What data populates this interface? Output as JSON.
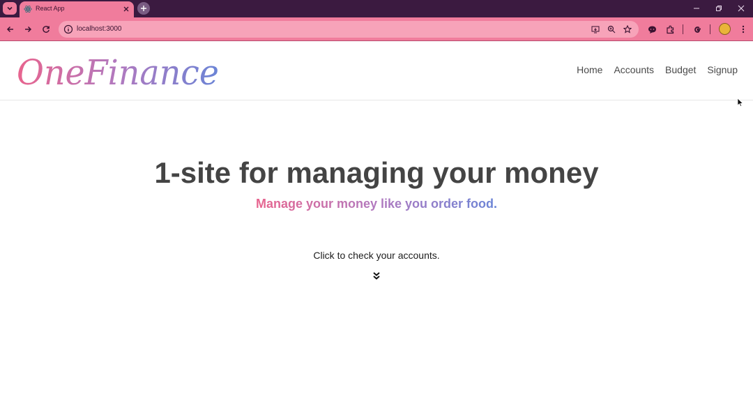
{
  "browser": {
    "tab": {
      "title": "React App"
    },
    "address_bar": {
      "url": "localhost:3000"
    },
    "icons": {
      "tab_search": "chevron-down-icon",
      "favicon": "react-icon",
      "tab_close": "close-icon",
      "new_tab": "plus-icon",
      "minimize": "minimize-icon",
      "restore": "restore-icon",
      "close": "close-icon",
      "back": "arrow-left-icon",
      "forward": "arrow-right-icon",
      "reload": "reload-icon",
      "site_info": "info-icon",
      "install": "install-app-icon",
      "zoom": "zoom-icon",
      "bookmark": "star-icon",
      "chat": "chat-icon",
      "extensions": "puzzle-icon",
      "google": "google-icon",
      "menu": "kebab-menu-icon"
    },
    "colors": {
      "titlebar": "#3b1a40",
      "toolbar": "#f07c9c",
      "omnibox": "#f7a3b9"
    }
  },
  "navbar": {
    "logo_text": "OneFinance",
    "links": [
      "Home",
      "Accounts",
      "Budget",
      "Signup"
    ]
  },
  "hero": {
    "title": "1-site for managing your money",
    "subtitle": "Manage your money like you order food.",
    "cta_text": "Click to check your accounts.",
    "cta_icon": "double-chevron-down-icon"
  },
  "colors": {
    "logo_gradient": [
      "#e8648e",
      "#b179bf",
      "#6a84d6"
    ],
    "title": "#444444"
  }
}
